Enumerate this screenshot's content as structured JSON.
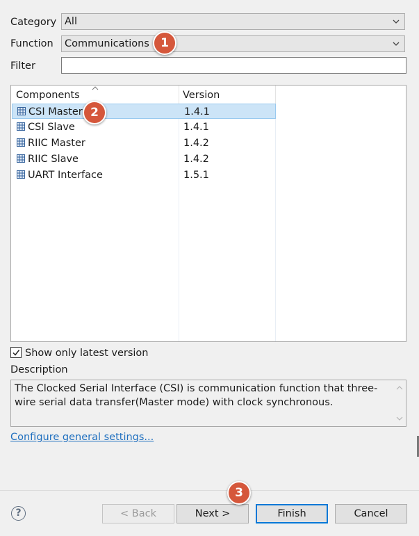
{
  "form": {
    "category_label": "Category",
    "category_value": "All",
    "function_label": "Function",
    "function_value": "Communications",
    "filter_label": "Filter",
    "filter_value": ""
  },
  "table": {
    "columns": [
      "Components",
      "Version"
    ],
    "rows": [
      {
        "name": "CSI Master",
        "version": "1.4.1",
        "selected": true
      },
      {
        "name": "CSI Slave",
        "version": "1.4.1",
        "selected": false
      },
      {
        "name": "RIIC Master",
        "version": "1.4.2",
        "selected": false
      },
      {
        "name": "RIIC Slave",
        "version": "1.4.2",
        "selected": false
      },
      {
        "name": "UART Interface",
        "version": "1.5.1",
        "selected": false
      }
    ]
  },
  "options": {
    "show_latest_label": "Show only latest version",
    "show_latest_checked": true
  },
  "description": {
    "label": "Description",
    "text": "The Clocked Serial Interface (CSI) is communication function that three-wire serial data transfer(Master mode) with clock synchronous."
  },
  "link": {
    "configure_label": "Configure general settings..."
  },
  "buttons": {
    "back": "< Back",
    "next": "Next >",
    "finish": "Finish",
    "cancel": "Cancel",
    "help": "?"
  },
  "badges": [
    "1",
    "2",
    "3"
  ],
  "colors": {
    "badge": "#d5573b",
    "selection": "#cce4f7",
    "link": "#1f6fbf",
    "default_button_border": "#0078d7"
  },
  "icons": {
    "component": "grid-component-icon",
    "dropdown": "chevron-down-icon",
    "sort": "sort-up-icon",
    "help": "help-icon"
  }
}
